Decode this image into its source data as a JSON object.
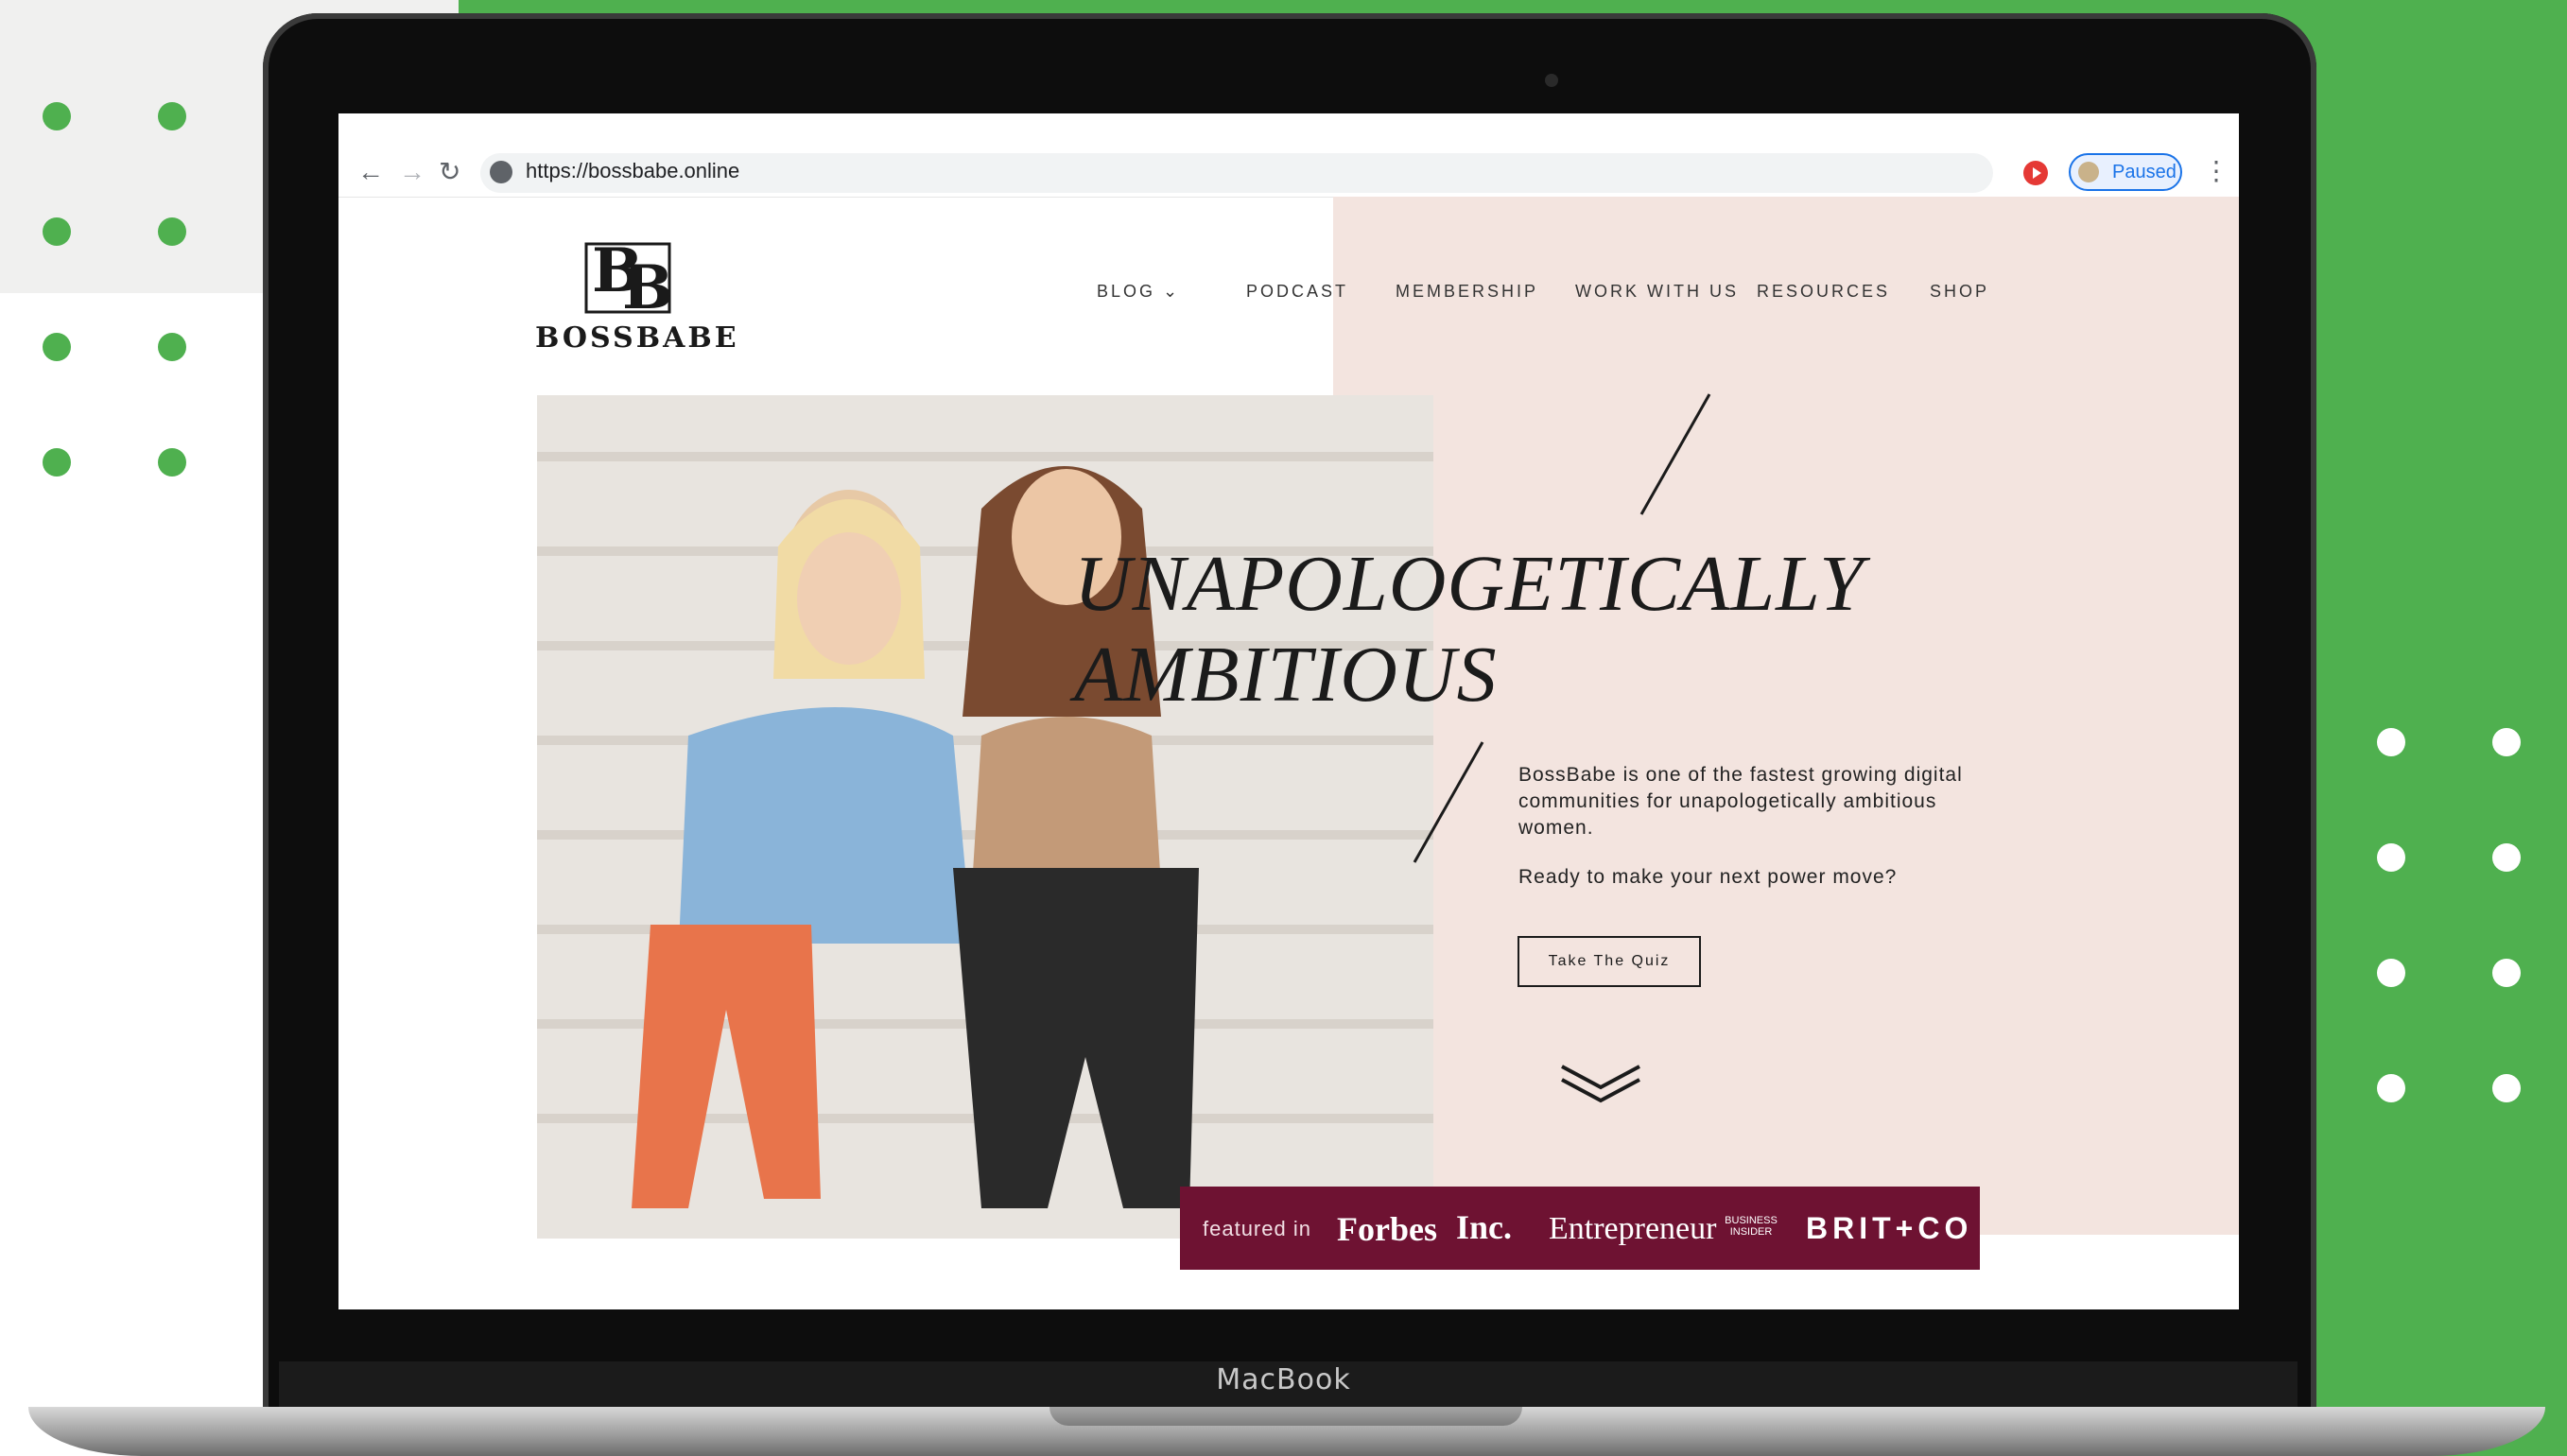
{
  "browser": {
    "url": "https://bossbabe.online",
    "paused_label": "Paused",
    "back_icon": "back-arrow-icon",
    "forward_icon": "forward-arrow-icon",
    "reload_icon": "reload-icon"
  },
  "site": {
    "logo_mark": "BB",
    "logo_text": "BOSSBABE",
    "nav": {
      "blog": "BLOG",
      "podcast": "PODCAST",
      "membership": "MEMBERSHIP",
      "work": "WORK WITH US",
      "resources": "RESOURCES",
      "shop": "SHOP"
    },
    "headline_line1": "UNAPOLOGETICALLY",
    "headline_line2": "AMBITIOUS",
    "body": "BossBabe is one of the fastest growing digital communities for unapologetically ambitious women.",
    "question": "Ready to make your next power move?",
    "cta": "Take The Quiz",
    "featured": {
      "label": "featured in",
      "forbes": "Forbes",
      "inc": "Inc.",
      "entrepreneur": "Entrepreneur",
      "business_insider": "BUSINESS INSIDER",
      "britco": "BRIT+CO"
    }
  },
  "laptop_label": "MacBook",
  "colors": {
    "green": "#4fb04f",
    "pink": "#f3e4df",
    "maroon": "#6e1232",
    "record": "#e53935",
    "accent_blue": "#1a73e8"
  }
}
